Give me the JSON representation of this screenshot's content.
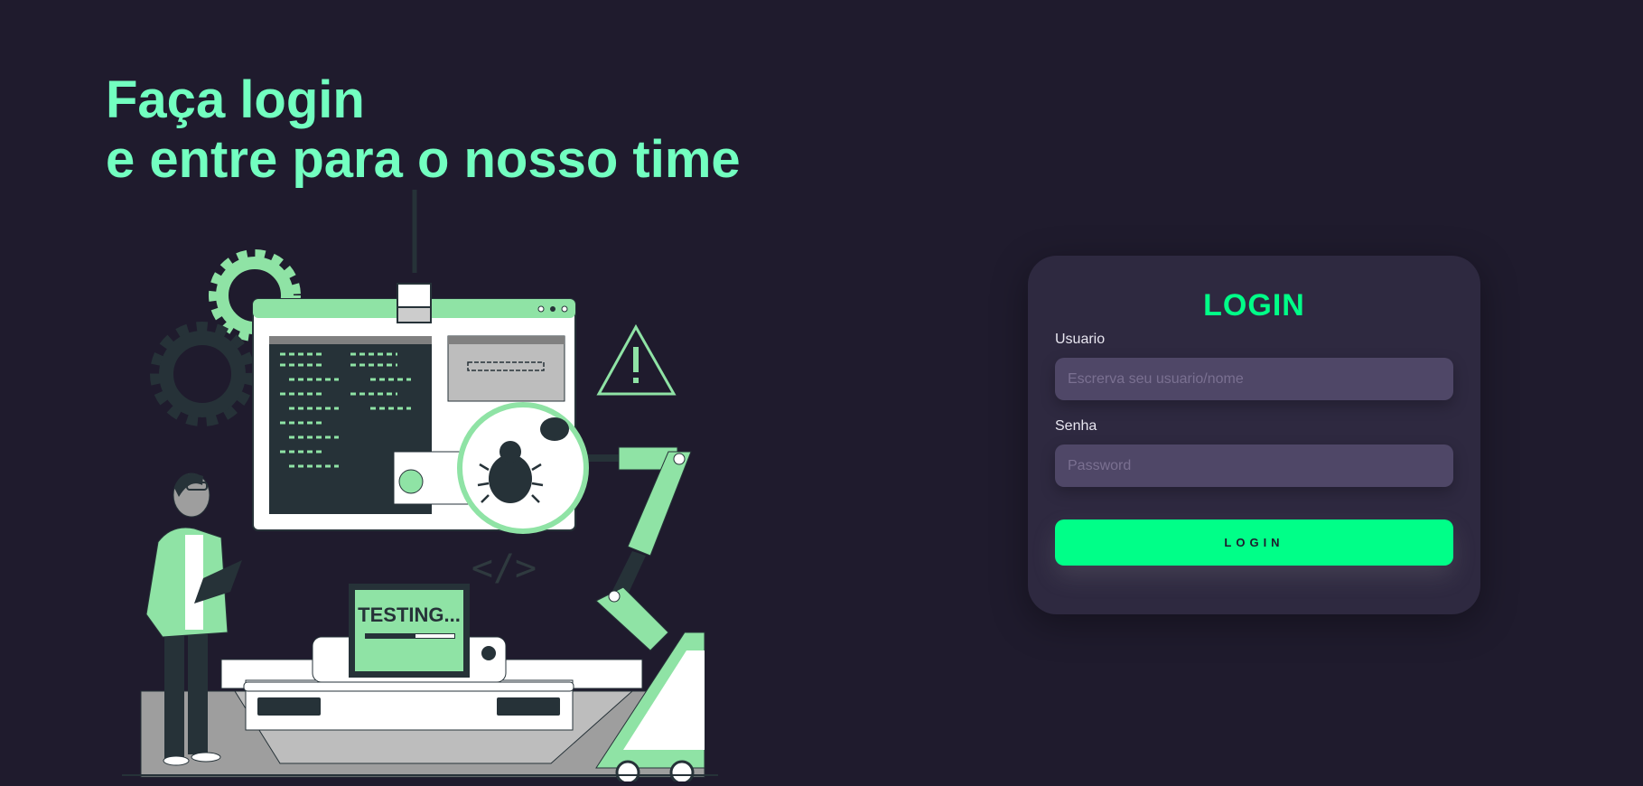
{
  "hero": {
    "line1": "Faça login",
    "line2": "e entre para o nosso time",
    "illustration_text": "TESTING..."
  },
  "login": {
    "title": "LOGIN",
    "username_label": "Usuario",
    "username_placeholder": "Escrerva seu usuario/nome",
    "password_label": "Senha",
    "password_placeholder": "Password",
    "submit_label": "LOGIN"
  },
  "colors": {
    "background": "#1f1b2d",
    "accent": "#00ff88",
    "headline": "#72ffc0",
    "card": "#2e2940",
    "input": "#4f4767",
    "illustration_green": "#8fe3a5",
    "illustration_dark": "#263238"
  }
}
